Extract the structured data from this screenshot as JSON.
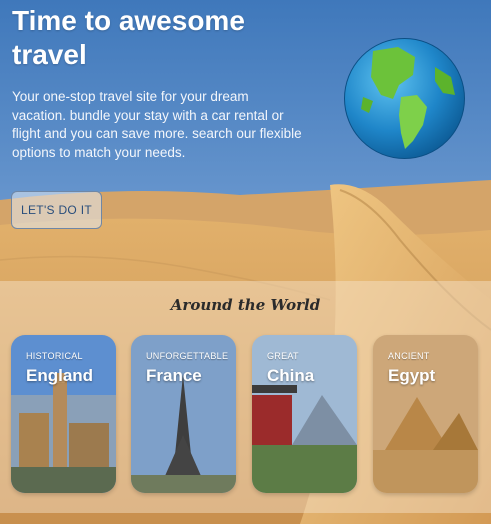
{
  "hero": {
    "title_line1": "Time to awesome",
    "title_line2": "travel",
    "description": "Your one-stop travel site for your dream vacation. bundle your stay with a car rental or flight and you can save more. search our flexible options to match your needs.",
    "cta_label": "LET'S DO IT"
  },
  "globe": {
    "icon": "globe-icon"
  },
  "section": {
    "title": "Around the World",
    "cards": [
      {
        "eyebrow": "HISTORICAL",
        "name": "England"
      },
      {
        "eyebrow": "UNFORGETTABLE",
        "name": "France"
      },
      {
        "eyebrow": "GREAT",
        "name": "China"
      },
      {
        "eyebrow": "ANCIENT",
        "name": "Egypt"
      }
    ]
  },
  "colors": {
    "sky": "#4f86c4",
    "sand": "#d9a463",
    "cta_text": "#294e7c",
    "ocean": "#1f86c9",
    "land": "#6cc23a"
  }
}
